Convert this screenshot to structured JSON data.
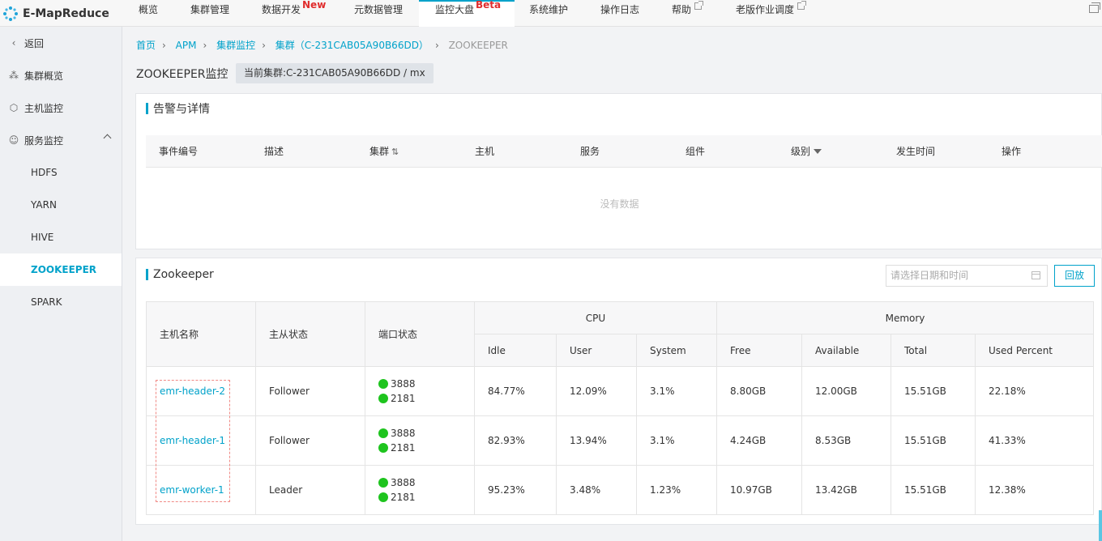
{
  "app": {
    "name": "E-MapReduce"
  },
  "nav": {
    "items": [
      {
        "label": "概览"
      },
      {
        "label": "集群管理"
      },
      {
        "label": "数据开发",
        "badge": "New"
      },
      {
        "label": "元数据管理"
      },
      {
        "label": "监控大盘",
        "badge": "Beta"
      },
      {
        "label": "系统维护"
      },
      {
        "label": "操作日志"
      },
      {
        "label": "帮助"
      },
      {
        "label": "老版作业调度"
      }
    ]
  },
  "sidebar": {
    "back": "返回",
    "items": [
      {
        "label": "集群概览"
      },
      {
        "label": "主机监控"
      },
      {
        "label": "服务监控"
      }
    ],
    "services": [
      "HDFS",
      "YARN",
      "HIVE",
      "ZOOKEEPER",
      "SPARK"
    ]
  },
  "breadcrumb": [
    "首页",
    "APM",
    "集群监控",
    "集群（C-231CAB05A90B66DD）",
    "ZOOKEEPER"
  ],
  "page": {
    "title": "ZOOKEEPER监控",
    "cluster_tag": "当前集群:C-231CAB05A90B66DD / mx"
  },
  "alerts": {
    "title": "告警与详情",
    "columns": [
      "事件编号",
      "描述",
      "集群",
      "主机",
      "服务",
      "组件",
      "级别",
      "发生时间",
      "操作"
    ],
    "empty_text": "没有数据"
  },
  "zookeeper": {
    "title": "Zookeeper",
    "date_placeholder": "请选择日期和时间",
    "playback_label": "回放",
    "headers": {
      "host": "主机名称",
      "role": "主从状态",
      "port": "端口状态",
      "cpu": "CPU",
      "memory": "Memory",
      "cpu_cols": [
        "Idle",
        "User",
        "System"
      ],
      "mem_cols": [
        "Free",
        "Available",
        "Total",
        "Used Percent"
      ]
    },
    "rows": [
      {
        "host": "emr-header-2",
        "role": "Follower",
        "ports": [
          "3888",
          "2181"
        ],
        "idle": "84.77%",
        "user": "12.09%",
        "system": "3.1%",
        "free": "8.80GB",
        "available": "12.00GB",
        "total": "15.51GB",
        "used_percent": "22.18%"
      },
      {
        "host": "emr-header-1",
        "role": "Follower",
        "ports": [
          "3888",
          "2181"
        ],
        "idle": "82.93%",
        "user": "13.94%",
        "system": "3.1%",
        "free": "4.24GB",
        "available": "8.53GB",
        "total": "15.51GB",
        "used_percent": "41.33%"
      },
      {
        "host": "emr-worker-1",
        "role": "Leader",
        "ports": [
          "3888",
          "2181"
        ],
        "idle": "95.23%",
        "user": "3.48%",
        "system": "1.23%",
        "free": "10.97GB",
        "available": "13.42GB",
        "total": "15.51GB",
        "used_percent": "12.38%"
      }
    ]
  },
  "colors": {
    "accent": "#00a2ca",
    "badge": "#e02d2d",
    "port_ok": "#1ec41e",
    "highlight": "#f08a85"
  }
}
